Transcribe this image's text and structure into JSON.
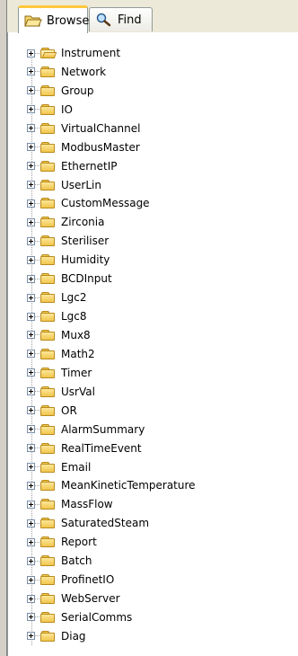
{
  "tabs": {
    "browse": {
      "label": "Browse",
      "icon": "folder-open-icon",
      "active": true
    },
    "find": {
      "label": "Find",
      "icon": "search-icon",
      "active": false
    }
  },
  "tree": {
    "items": [
      {
        "label": "Instrument",
        "icon": "folder-open-icon"
      },
      {
        "label": "Network",
        "icon": "folder-icon"
      },
      {
        "label": "Group",
        "icon": "folder-icon"
      },
      {
        "label": "IO",
        "icon": "folder-icon"
      },
      {
        "label": "VirtualChannel",
        "icon": "folder-icon"
      },
      {
        "label": "ModbusMaster",
        "icon": "folder-icon"
      },
      {
        "label": "EthernetIP",
        "icon": "folder-icon"
      },
      {
        "label": "UserLin",
        "icon": "folder-icon"
      },
      {
        "label": "CustomMessage",
        "icon": "folder-icon"
      },
      {
        "label": "Zirconia",
        "icon": "folder-icon"
      },
      {
        "label": "Steriliser",
        "icon": "folder-icon"
      },
      {
        "label": "Humidity",
        "icon": "folder-icon"
      },
      {
        "label": "BCDInput",
        "icon": "folder-icon"
      },
      {
        "label": "Lgc2",
        "icon": "folder-icon"
      },
      {
        "label": "Lgc8",
        "icon": "folder-icon"
      },
      {
        "label": "Mux8",
        "icon": "folder-icon"
      },
      {
        "label": "Math2",
        "icon": "folder-icon"
      },
      {
        "label": "Timer",
        "icon": "folder-icon"
      },
      {
        "label": "UsrVal",
        "icon": "folder-icon"
      },
      {
        "label": "OR",
        "icon": "folder-icon"
      },
      {
        "label": "AlarmSummary",
        "icon": "folder-icon"
      },
      {
        "label": "RealTimeEvent",
        "icon": "folder-icon"
      },
      {
        "label": "Email",
        "icon": "folder-icon"
      },
      {
        "label": "MeanKineticTemperature",
        "icon": "folder-icon"
      },
      {
        "label": "MassFlow",
        "icon": "folder-icon"
      },
      {
        "label": "SaturatedSteam",
        "icon": "folder-icon"
      },
      {
        "label": "Report",
        "icon": "folder-icon"
      },
      {
        "label": "Batch",
        "icon": "folder-icon"
      },
      {
        "label": "ProfinetIO",
        "icon": "folder-icon"
      },
      {
        "label": "WebServer",
        "icon": "folder-icon"
      },
      {
        "label": "SerialComms",
        "icon": "folder-icon"
      },
      {
        "label": "Diag",
        "icon": "folder-icon"
      }
    ]
  },
  "colors": {
    "tab_active_accent": "#ffc83c",
    "folder_fill": "#f1c64c",
    "folder_outline": "#b88a1c",
    "tab_border": "#919b9c",
    "tree_background": "#ffffff"
  }
}
